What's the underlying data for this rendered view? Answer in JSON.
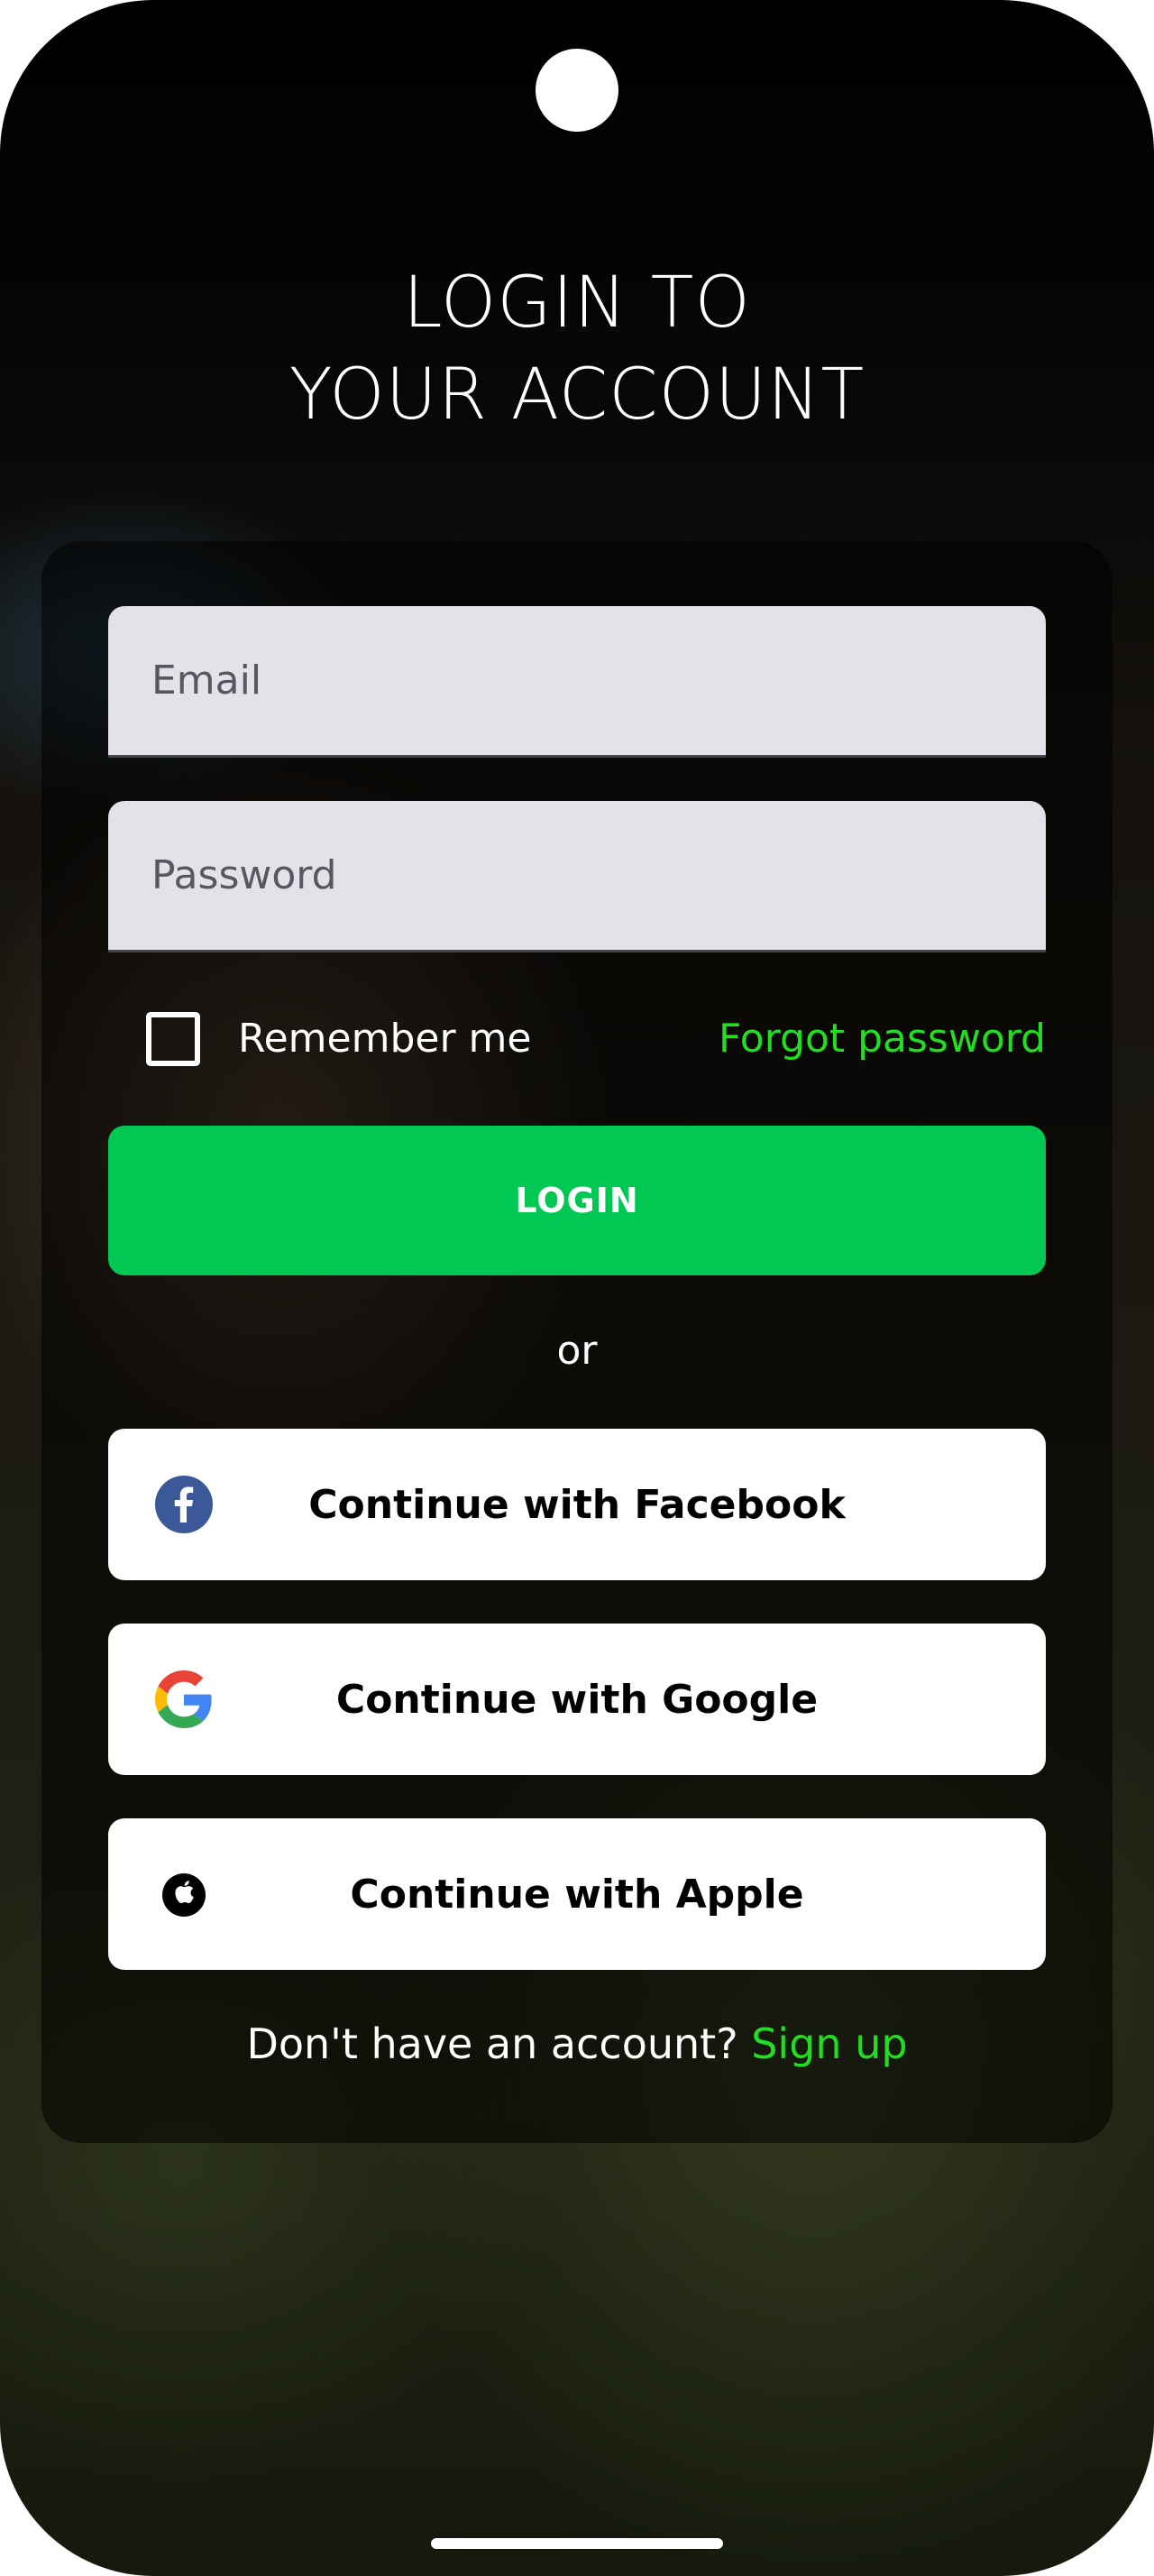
{
  "header": {
    "title_line1": "LOGIN TO",
    "title_line2": "YOUR ACCOUNT"
  },
  "form": {
    "email_placeholder": "Email",
    "password_placeholder": "Password",
    "remember_label": "Remember me",
    "remember_checked": false,
    "forgot_label": "Forgot password",
    "login_label": "LOGIN",
    "or_label": "or"
  },
  "social": {
    "facebook_label": "Continue with Facebook",
    "google_label": "Continue with Google",
    "apple_label": "Continue with Apple"
  },
  "footer": {
    "signup_prompt": "Don't have an account?",
    "signup_link": "Sign up"
  },
  "colors": {
    "accent_green": "#22dd22",
    "login_button": "#00c853",
    "facebook_blue": "#3b5998"
  },
  "icons": {
    "facebook": "facebook-icon",
    "google": "google-icon",
    "apple": "apple-icon"
  }
}
